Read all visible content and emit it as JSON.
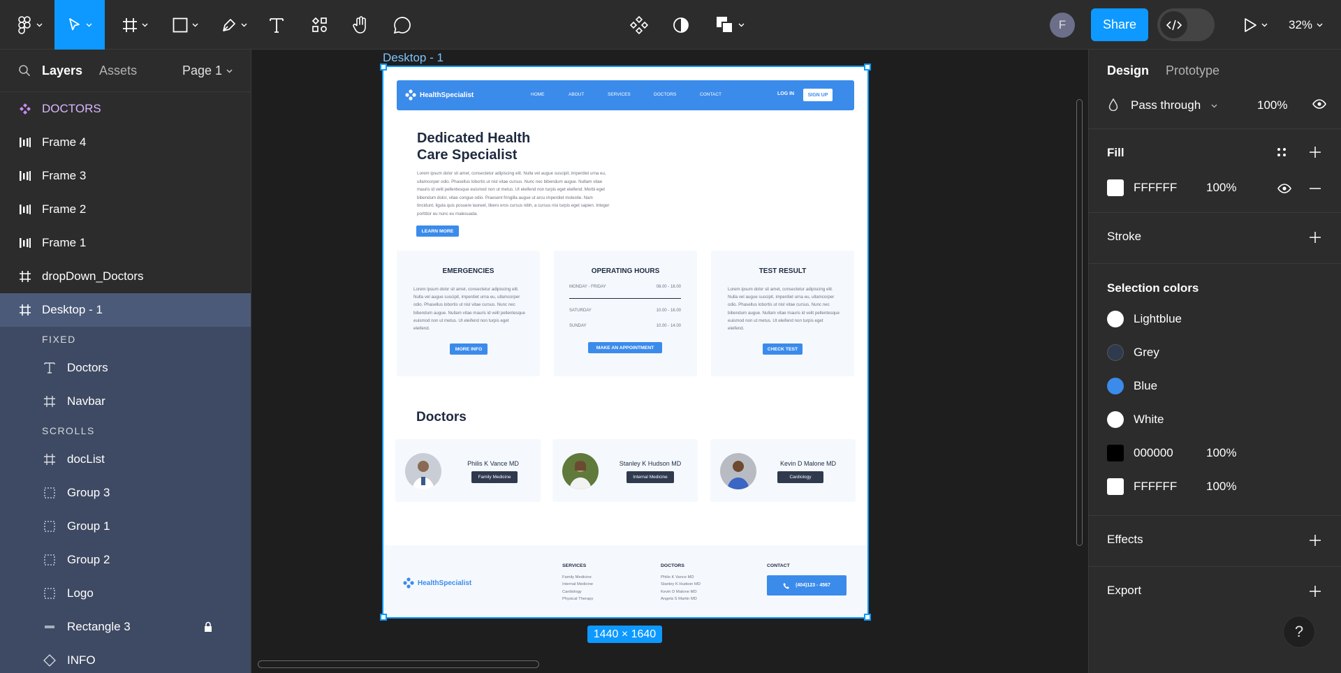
{
  "toolbar": {
    "share_label": "Share",
    "avatar_initial": "F",
    "zoom": "32%"
  },
  "left_panel": {
    "tabs": {
      "layers": "Layers",
      "assets": "Assets"
    },
    "page": "Page 1",
    "layers": [
      {
        "label": "DOCTORS",
        "icon": "component-icon"
      },
      {
        "label": "Frame 4",
        "icon": "auto-layout-icon"
      },
      {
        "label": "Frame 3",
        "icon": "auto-layout-icon"
      },
      {
        "label": "Frame 2",
        "icon": "auto-layout-icon"
      },
      {
        "label": "Frame 1",
        "icon": "auto-layout-icon"
      },
      {
        "label": "dropDown_Doctors",
        "icon": "frame-icon"
      },
      {
        "label": "Desktop - 1",
        "icon": "frame-icon"
      }
    ],
    "fixed_label": "FIXED",
    "fixed_children": [
      {
        "label": "Doctors",
        "icon": "text-icon"
      },
      {
        "label": "Navbar",
        "icon": "frame-icon"
      }
    ],
    "scrolls_label": "SCROLLS",
    "scroll_children": [
      {
        "label": "docList",
        "icon": "frame-icon"
      },
      {
        "label": "Group 3",
        "icon": "group-icon"
      },
      {
        "label": "Group 1",
        "icon": "group-icon"
      },
      {
        "label": "Group 2",
        "icon": "group-icon"
      },
      {
        "label": "Logo",
        "icon": "group-icon"
      },
      {
        "label": "Rectangle 3",
        "icon": "rectangle-icon"
      },
      {
        "label": "INFO",
        "icon": "instance-icon"
      }
    ]
  },
  "canvas": {
    "frame_label": "Desktop - 1",
    "dimensions": "1440 × 1640"
  },
  "mock": {
    "brand": "HealthSpecialist",
    "nav_links": [
      "HOME",
      "ABOUT",
      "SERVICES",
      "DOCTORS",
      "CONTACT"
    ],
    "login": "LOG IN",
    "signup": "SIGN UP",
    "hero_title": "Dedicated Health Care Specialist",
    "hero_text": "Lorem ipsum dolor sit amet, consectetur adipiscing elit. Nulla vel augue suscipit, imperdiet urna eu, ullamcorper odio. Phasellus lobortis ut nisl vitae cursus. Nunc nec bibendum augue. Nullam vitae mauris id velit pellentesque euismod non ut metus. Ut eleifend non turpis eget eleifend. Morbi eget bibendum dolor, vitae congue odio. Praesent fringilla augue ut arcu imperdiet molestie. Nam tincidunt, ligula quis posuere laoreet, libero eros cursus nibh, a cursus nisi turpis eget sapien. Integer porttitor eu nunc eu malesuada.",
    "learn_more": "LEARN MORE",
    "card_text": "Lorem ipsum dolor sit amet, consectetur adipiscing elit. Nulla vel augue suscipit, imperdiet urna eu, ullamcorper odio. Phasellus lobortis ut nisl vitae cursus. Nunc nec bibendum augue. Nullam vitae mauris id velit pellentesque euismod non ut metus. Ut eleifend non turpis eget eleifend.",
    "emergencies": {
      "title": "EMERGENCIES",
      "button": "MORE INFO"
    },
    "hours": {
      "title": "OPERATING HOURS",
      "rows": [
        {
          "day": "MONDAY - FRIDAY",
          "time": "08.00 - 18.00"
        },
        {
          "day": "SATURDAY",
          "time": "10.00 - 16.00"
        },
        {
          "day": "SUNDAY",
          "time": "10.00 - 14.00"
        }
      ],
      "button": "MAKE AN APPOINTMENT"
    },
    "test": {
      "title": "TEST RESULT",
      "button": "CHECK TEST"
    },
    "doctors_heading": "Doctors",
    "doctors": [
      {
        "name": "Philis K Vance MD",
        "specialty": "Family Medicine"
      },
      {
        "name": "Stanley K Hudson MD",
        "specialty": "Internal Medicine"
      },
      {
        "name": "Kevin D Malone MD",
        "specialty": "Cardiology"
      }
    ],
    "footer": {
      "services_title": "SERVICES",
      "services": [
        "Family Medicine",
        "Internal Medicine",
        "Cardiology",
        "Physical Therapy"
      ],
      "doctors_title": "DOCTORS",
      "doctors": [
        "Philis K Vance MD",
        "Stanley K Hudson MD",
        "Kevin D Malone MD",
        "Angela S Martin MD"
      ],
      "contact_title": "CONTACT",
      "phone": "(404)123 - 4567"
    }
  },
  "right_panel": {
    "tabs": {
      "design": "Design",
      "prototype": "Prototype"
    },
    "layer_blend": "Pass through",
    "layer_opacity": "100%",
    "fill_title": "Fill",
    "fill": {
      "hex": "FFFFFF",
      "opacity": "100%",
      "color": "#ffffff"
    },
    "stroke_title": "Stroke",
    "selection_colors_title": "Selection colors",
    "selection_colors": [
      {
        "name": "Lightblue",
        "color": "#ffffff",
        "style": true
      },
      {
        "name": "Grey",
        "color": "#2f3a4f",
        "style": true
      },
      {
        "name": "Blue",
        "color": "#3b8beb",
        "style": true
      },
      {
        "name": "White",
        "color": "#ffffff",
        "style": true
      },
      {
        "name": "000000",
        "opacity": "100%",
        "color": "#000000",
        "style": false
      },
      {
        "name": "FFFFFF",
        "opacity": "100%",
        "color": "#ffffff",
        "style": false
      }
    ],
    "effects_title": "Effects",
    "export_title": "Export"
  },
  "help_label": "?"
}
